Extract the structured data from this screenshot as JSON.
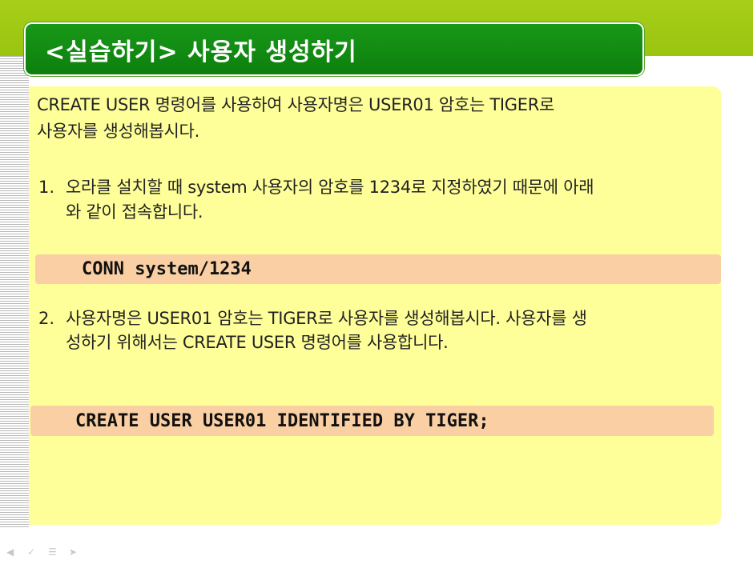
{
  "slide": {
    "title": "<실습하기> 사용자 생성하기",
    "intro_line1": "CREATE USER 명령어를 사용하여 사용자명은 USER01 암호는 TIGER로",
    "intro_line2": "사용자를 생성해봅시다.",
    "steps": [
      {
        "number": "1.",
        "line1": "오라클 설치할 때 system 사용자의 암호를 1234로 지정하였기 때문에 아래",
        "line2": "와 같이 접속합니다.",
        "code": "CONN system/1234"
      },
      {
        "number": "2.",
        "line1": "사용자명은 USER01 암호는 TIGER로 사용자를 생성해봅시다. 사용자를 생",
        "line2": "성하기 위해서는 CREATE USER 명령어를 사용합니다.",
        "code": "CREATE USER USER01 IDENTIFIED BY TIGER;"
      }
    ]
  },
  "nav": {
    "icons": [
      "prev-icon",
      "next-icon",
      "menu-icon",
      "arrow-icon"
    ]
  },
  "colors": {
    "top_band": "#a7cf1a",
    "title_bg": "#128c12",
    "panel_bg": "#ffff99",
    "code_bg": "#f9cfa3"
  }
}
